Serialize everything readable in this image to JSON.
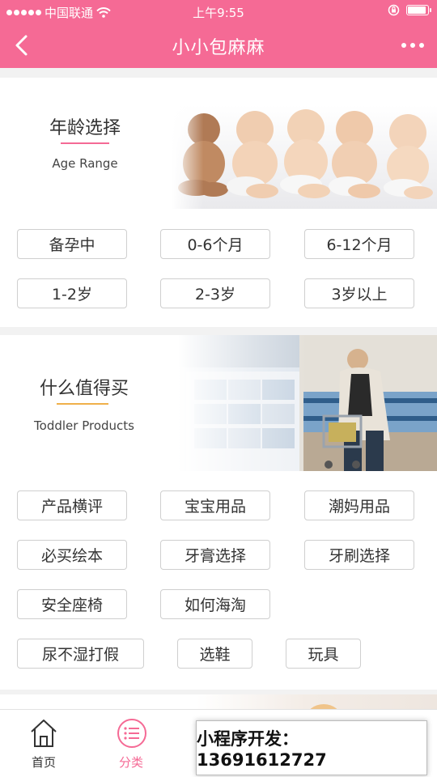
{
  "status_bar": {
    "carrier": "中国联通",
    "time": "上午9:55"
  },
  "nav": {
    "title": "小小包麻麻",
    "back_icon": "chevron-left-icon",
    "more_icon": "more-dots-icon"
  },
  "age_section": {
    "title": "年龄选择",
    "subtitle": "Age Range",
    "accent": "#f56a95",
    "tags": [
      "备孕中",
      "0-6个月",
      "6-12个月",
      "1-2岁",
      "2-3岁",
      "3岁以上"
    ]
  },
  "products_section": {
    "title": "什么值得买",
    "subtitle": "Toddler Products",
    "accent": "#f0b04a",
    "tags": [
      "产品横评",
      "宝宝用品",
      "潮妈用品",
      "必买绘本",
      "牙膏选择",
      "牙刷选择",
      "安全座椅",
      "如何海淘",
      "尿不湿打假",
      "选鞋",
      "玩具"
    ]
  },
  "tabbar": {
    "active_color": "#f56a95",
    "items": [
      {
        "label": "首页",
        "icon": "home-icon"
      },
      {
        "label": "分类",
        "icon": "category-icon"
      }
    ]
  },
  "promo": {
    "text": "小程序开发：13691612727"
  }
}
